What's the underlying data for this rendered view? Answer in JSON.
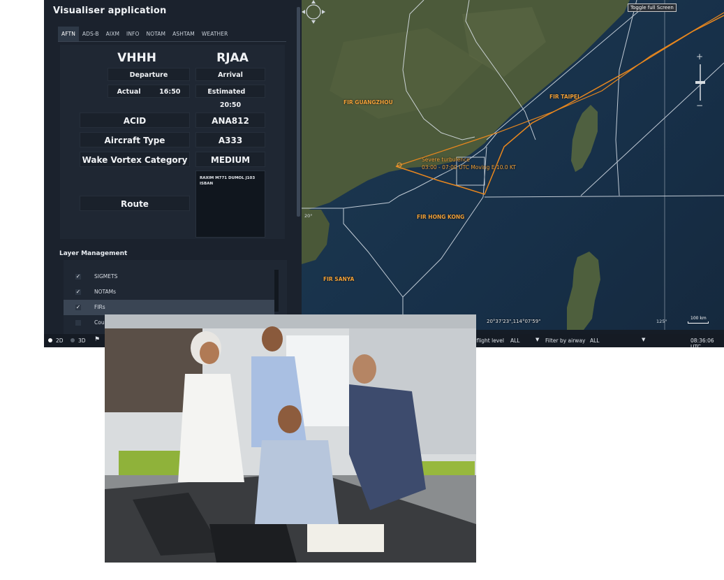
{
  "app": {
    "title": "Visualiser application"
  },
  "tabs": [
    "AFTN",
    "ADS-B",
    "AIXM",
    "INFO",
    "NOTAM",
    "ASHTAM",
    "WEATHER"
  ],
  "aftn": {
    "departure_code": "VHHH",
    "arrival_code": "RJAA",
    "departure_label": "Departure",
    "arrival_label": "Arrival",
    "actual_label": "Actual",
    "actual_time": "16:50",
    "estimated_label": "Estimated",
    "estimated_time": "20:50",
    "acid_label": "ACID",
    "acid_value": "ANA812",
    "aircraft_type_label": "Aircraft Type",
    "aircraft_type_value": "A333",
    "wake_label": "Wake Vortex Category",
    "wake_value": "MEDIUM",
    "route_label": "Route",
    "route_value": "RAXIM M771 DUMOL J103 ISBAN"
  },
  "layers": {
    "title": "Layer Management",
    "items": [
      {
        "label": "SIGMETS",
        "checked": true,
        "selected": false
      },
      {
        "label": "NOTAMs",
        "checked": true,
        "selected": false
      },
      {
        "label": "FIRs",
        "checked": true,
        "selected": true
      },
      {
        "label": "Cou",
        "checked": false,
        "selected": false
      }
    ]
  },
  "map": {
    "fullscreen_label": "Toggle full Screen",
    "fir_labels": [
      "FIR GUANGZHOU",
      "FIR TAIPEI",
      "FIR HONG KONG",
      "FIR SANYA"
    ],
    "sigmet_line1": "Severe turbulence",
    "sigmet_line2": "03:00 - 07:00 UTC Moving E 10.0 KT",
    "coordinate": "20°37'23\",114°07'59\"",
    "scale": "100 km",
    "grid_lat": "20°",
    "grid_lon": "125°",
    "route_color": "#e8871e",
    "fir_line_color": "#dfe6ee"
  },
  "status": {
    "mode_2d": "2D",
    "mode_3d": "3D",
    "flight_level_label": "r flight level",
    "flight_level_value": "ALL",
    "airway_label": "Filter by airway",
    "airway_value": "ALL",
    "clock": "08:36:06 UTC"
  }
}
